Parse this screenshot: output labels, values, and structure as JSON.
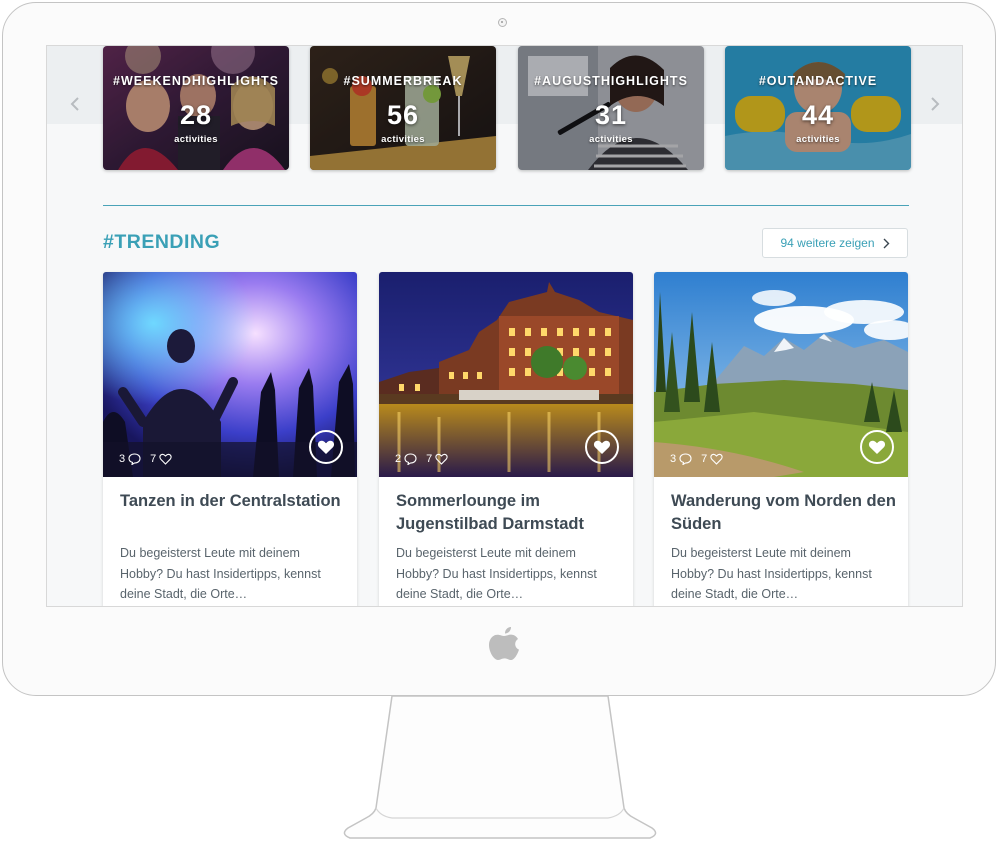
{
  "highlights": [
    {
      "tag": "#WEEKENDHIGHLIGHTS",
      "count": "28",
      "unit": "activities"
    },
    {
      "tag": "#SUMMERBREAK",
      "count": "56",
      "unit": "activities"
    },
    {
      "tag": "#AUGUSTHIGHLIGHTS",
      "count": "31",
      "unit": "activities"
    },
    {
      "tag": "#OUTANDACTIVE",
      "count": "44",
      "unit": "activities"
    }
  ],
  "trending": {
    "title": "#TRENDING",
    "more_label": "94 weitere zeigen",
    "cards": [
      {
        "comments": "3",
        "likes": "7",
        "title": "Tanzen in der Centralstation",
        "description": "Du begeisterst Leute mit deinem Hobby? Du hast Insidertipps, kennst deine Stadt, die Orte…"
      },
      {
        "comments": "2",
        "likes": "7",
        "title": "Sommerlounge im Jugenstilbad Darmstadt",
        "description": "Du begeisterst Leute mit deinem Hobby? Du hast Insidertipps, kennst deine Stadt, die Orte…"
      },
      {
        "comments": "3",
        "likes": "7",
        "title": "Wanderung vom Norden den Süden",
        "description": "Du begeisterst Leute mit deinem Hobby? Du hast Insidertipps, kennst deine Stadt, die Orte…"
      }
    ]
  },
  "icons": {
    "carousel_prev": "chevron-left-icon",
    "carousel_next": "chevron-right-icon",
    "more": "chevron-right-icon",
    "comments": "speech-bubble-icon",
    "likes": "heart-outline-icon",
    "like_button": "heart-icon",
    "camera": "camera-icon",
    "brand": "apple-logo"
  },
  "colors": {
    "accent": "#3aa0b6",
    "card_title": "#3e4a54",
    "card_text": "#59646c",
    "screen_background": "#f7f8f9"
  }
}
